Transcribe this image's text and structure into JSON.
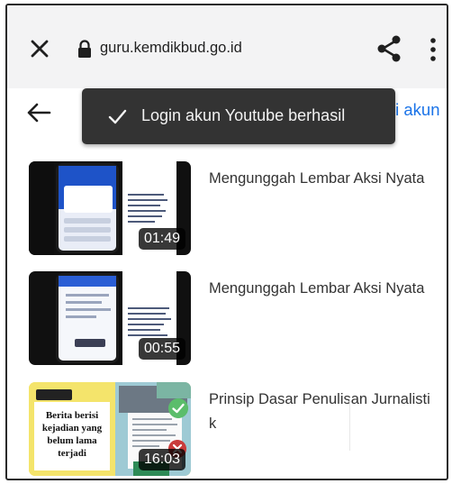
{
  "browser": {
    "url": "guru.kemdikbud.go.id",
    "icons": {
      "close": "close-icon",
      "lock": "lock-icon",
      "share": "share-icon",
      "menu": "more-vert-icon"
    }
  },
  "appbar": {
    "back_icon": "arrow-back-icon",
    "link_text": "ti akun"
  },
  "toast": {
    "icon": "check-icon",
    "message": "Login akun Youtube berhasil"
  },
  "videos": [
    {
      "title": "Mengunggah Lembar Aksi Nyata",
      "duration": "01:49"
    },
    {
      "title": "Mengunggah Lembar Aksi Nyata",
      "duration": "00:55"
    },
    {
      "title": "Prinsip Dasar Penulisan Jurnalistik",
      "duration": "16:03",
      "thumb_text": "Berita berisi kejadian yang belum lama terjadi"
    }
  ],
  "colors": {
    "accent": "#1a73e8",
    "toast_bg": "#333333",
    "browser_bar": "#f3f3f4"
  }
}
